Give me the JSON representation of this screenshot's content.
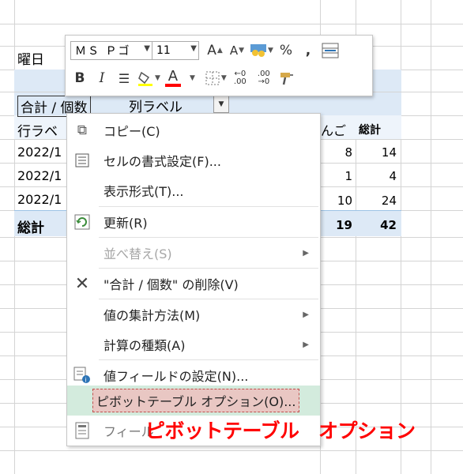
{
  "mini_toolbar": {
    "font_name": "ＭＳ Ｐゴ",
    "font_size": "11",
    "grow_font": "A",
    "shrink_font": "A",
    "percent": "%",
    "comma": ",",
    "bold": "B",
    "italic": "I",
    "font_color_letter": "A",
    "increase_decimal": "←0 .00",
    "decrease_decimal": ".00 →0"
  },
  "sheet": {
    "weekday_label": "曜日",
    "values_header": "合計 / 個数",
    "column_label_header": "列ラベル",
    "row_label_header": "行ラベ",
    "partial_header": "んご",
    "total_header": "総計",
    "rows": [
      {
        "label": "2022/1",
        "v1": "8",
        "v2": "14"
      },
      {
        "label": "2022/1",
        "v1": "1",
        "v2": "4"
      },
      {
        "label": "2022/1",
        "v1": "10",
        "v2": "24"
      }
    ],
    "grand_total_label": "総計",
    "grand_total_v1": "19",
    "grand_total_v2": "42"
  },
  "context_menu": {
    "items": [
      {
        "label": "コピー(C)",
        "icon": "copy-icon"
      },
      {
        "label": "セルの書式設定(F)...",
        "icon": "format-cells-icon"
      },
      {
        "label": "表示形式(T)...",
        "icon": ""
      },
      {
        "label": "更新(R)",
        "icon": "refresh-icon"
      },
      {
        "label": "並べ替え(S)",
        "icon": ""
      },
      {
        "label": "\"合計 / 個数\" の削除(V)",
        "icon": "delete-x-icon"
      },
      {
        "label": "値の集計方法(M)",
        "icon": ""
      },
      {
        "label": "計算の種類(A)",
        "icon": ""
      },
      {
        "label": "値フィールドの設定(N)...",
        "icon": "field-settings-icon"
      },
      {
        "label": "ピボットテーブル オプション(O)...",
        "icon": ""
      },
      {
        "label": "フィール",
        "icon": "field-list-icon"
      }
    ]
  },
  "annotation": "ピボットテーブル　オプション",
  "colors": {
    "highlight": "#dde9f6",
    "active_item": "#d3ebdd",
    "annotation": "#ff0000",
    "font_color_bar": "#ff0000"
  }
}
